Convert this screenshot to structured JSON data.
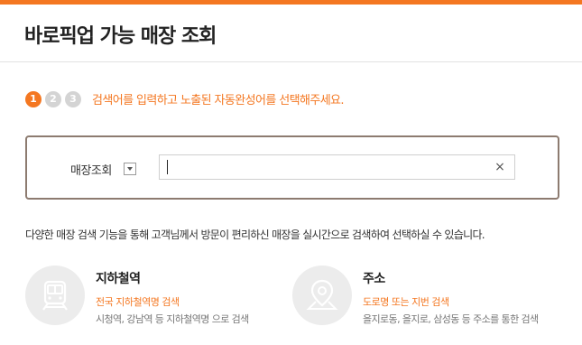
{
  "header": {
    "title": "바로픽업 가능 매장 조회"
  },
  "steps": {
    "numbers": [
      "1",
      "2",
      "3"
    ],
    "active_index": 0,
    "message": "검색어를 입력하고 노출된 자동완성어를 선택해주세요."
  },
  "search": {
    "label": "매장조회",
    "value": "",
    "clear_symbol": "×"
  },
  "description": "다양한 매장 검색 기능을 통해 고객님께서 방문이 편리하신 매장을 실시간으로 검색하여 선택하실 수 있습니다.",
  "options": [
    {
      "title": "지하철역",
      "subtitle": "전국 지하철역명 검색",
      "example": "시청역, 강남역 등 지하철역명 으로 검색",
      "icon": "subway-icon"
    },
    {
      "title": "주소",
      "subtitle": "도로명 또는 지번 검색",
      "example": "을지로동, 을지로, 삼성동 등 주소를 통한 검색",
      "icon": "map-pin-icon"
    }
  ],
  "colors": {
    "accent": "#f47721",
    "box_border": "#8d7b70",
    "step_inactive": "#d4d4d4",
    "icon_bg": "#ececec"
  }
}
